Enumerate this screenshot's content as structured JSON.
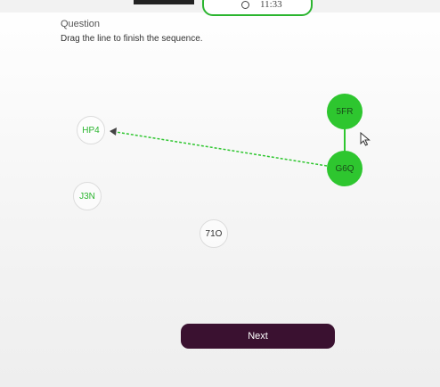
{
  "status_bar": {
    "time": "11:33"
  },
  "question": {
    "label": "Question",
    "instruction": "Drag the line to finish the sequence."
  },
  "nodes": {
    "n1": {
      "label": "5FR",
      "state": "connected"
    },
    "n2": {
      "label": "G6Q",
      "state": "connected"
    },
    "n3": {
      "label": "HP4",
      "state": "drag-target"
    },
    "n4": {
      "label": "J3N",
      "state": "unconnected"
    },
    "n5": {
      "label": "71O",
      "state": "unconnected"
    }
  },
  "next_button": {
    "label": "Next"
  },
  "colors": {
    "accent_green": "#2ec62f",
    "button_dark": "#3a1130",
    "timer_border": "#2bb52f"
  }
}
